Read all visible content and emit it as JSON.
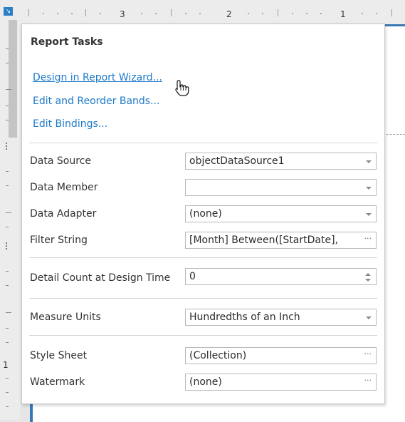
{
  "ruler": {
    "numbers": [
      "3",
      "2",
      "1"
    ],
    "vertical_number": "1"
  },
  "panel": {
    "title": "Report Tasks",
    "links": [
      {
        "label": "Design in Report Wizard..."
      },
      {
        "label": "Edit and Reorder Bands..."
      },
      {
        "label": "Edit Bindings..."
      }
    ],
    "properties": [
      {
        "label": "Data Source",
        "value": "objectDataSource1",
        "editor": "dropdown"
      },
      {
        "label": "Data Member",
        "value": "",
        "editor": "dropdown"
      },
      {
        "label": "Data Adapter",
        "value": "(none)",
        "editor": "dropdown"
      },
      {
        "label": "Filter String",
        "value": "[Month] Between([StartDate],",
        "editor": "ellipsis"
      },
      {
        "label": "Detail Count at Design Time",
        "value": "0",
        "editor": "spin"
      },
      {
        "label": "Measure Units",
        "value": "Hundredths of an Inch",
        "editor": "dropdown"
      },
      {
        "label": "Style Sheet",
        "value": "(Collection)",
        "editor": "ellipsis"
      },
      {
        "label": "Watermark",
        "value": "(none)",
        "editor": "ellipsis"
      }
    ],
    "ellipsis_glyph": "···"
  },
  "colors": {
    "link": "#1e7ac8",
    "accent": "#3a78b5"
  },
  "icons": {
    "cursor": "hand-pointer-icon",
    "corner": "collapse-arrow-icon"
  }
}
